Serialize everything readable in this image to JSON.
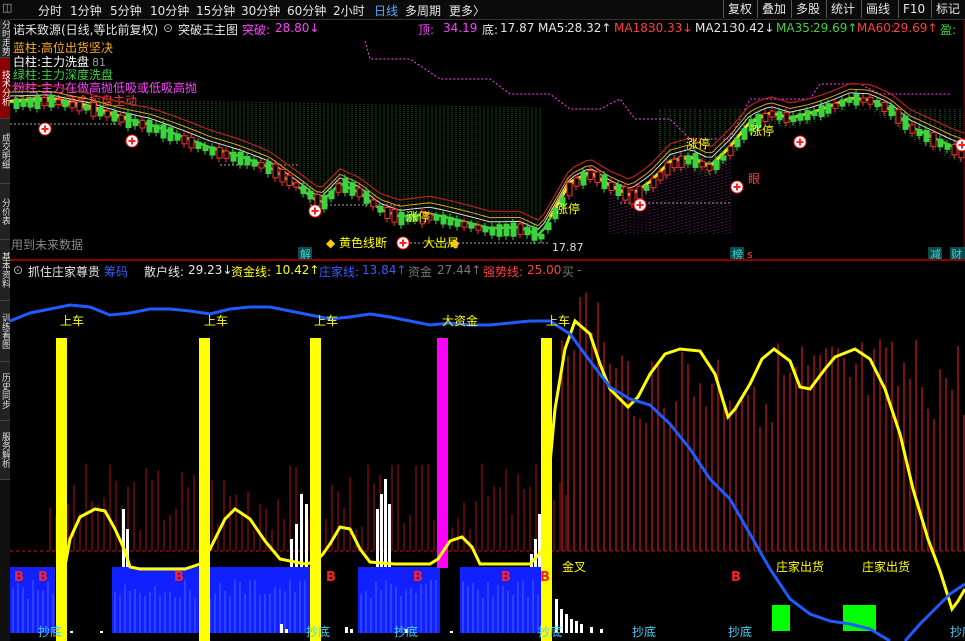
{
  "toolbar": {
    "timeframes": [
      "分时",
      "1分钟",
      "5分钟",
      "10分钟",
      "15分钟",
      "30分钟",
      "60分钟",
      "2小时",
      "日线",
      "多周期",
      "更多〉"
    ],
    "active_timeframe": "日线",
    "right_buttons": [
      "复权",
      "叠加",
      "多股",
      "统计",
      "画线",
      "F10",
      "标记"
    ]
  },
  "left_tabs": [
    "分时走势",
    "技术分析",
    "成交明细",
    "分价表",
    "基本资料",
    "训练看图",
    "历史同步",
    "服务解析"
  ],
  "upper": {
    "stock_name": "诺禾致源(日线,等比前复权)",
    "indicator_name": "突破王主图",
    "breakout_label": "突破:",
    "breakout_value": "28.80↓",
    "top_label": "顶:",
    "top_value": "34.19",
    "bottom_label": "底:",
    "bottom_value": "17.87",
    "ma": [
      {
        "label": "MA5:",
        "value": "28.32↑",
        "color": "#e6e6e6"
      },
      {
        "label": "MA18:",
        "value": "30.33↓",
        "color": "#ff4040"
      },
      {
        "label": "MA21:",
        "value": "30.42↓",
        "color": "#e6e6e6"
      },
      {
        "label": "MA35:",
        "value": "29.69↑",
        "color": "#3fd13f"
      },
      {
        "label": "MA60:",
        "value": "29.69↑",
        "color": "#ff4040"
      },
      {
        "label": "盈:",
        "value": "",
        "color": "#3fd13f"
      }
    ],
    "legend": [
      {
        "text": "蓝柱:高位出货坚决",
        "color": "#ffb020"
      },
      {
        "text": "白柱:主力洗盘",
        "color": "#ffffff"
      },
      {
        "text": "绿柱:主力深度洗盘",
        "color": "#3fd13f"
      },
      {
        "text": "粉柱:主力在做高抛低吸或低吸高抛",
        "color": "#ff40ff"
      },
      {
        "text": "红柱:主力资金控盘主动",
        "color": "#ff4040"
      }
    ],
    "legend_extra": "81",
    "future_data": "用到未来数据",
    "annotations": {
      "zhangting": "涨停",
      "yan": "眼",
      "low_price": "17.87",
      "jie": "解",
      "bang": "榜",
      "s": "s",
      "jian": "减",
      "cai": "财"
    },
    "bottom_legend": [
      "黄色线断",
      "大出局"
    ]
  },
  "lower": {
    "indicator_name": "抓住庄家尊贵",
    "items": [
      {
        "label": "筹码",
        "value": "",
        "color": "#3a5cff"
      },
      {
        "label": "散户线:",
        "value": "29.23↓",
        "color": "#e6e6e6"
      },
      {
        "label": "资金线:",
        "value": "10.42↑",
        "color": "#ffff00"
      },
      {
        "label": "庄家线:",
        "value": "13.84↑",
        "color": "#3a5cff"
      },
      {
        "label": "资金",
        "value": "27.44↑",
        "color": "#777777"
      },
      {
        "label": "强势线:",
        "value": "25.00",
        "color": "#ff4040"
      },
      {
        "label": "买",
        "value": "-",
        "color": "#777777"
      }
    ],
    "signals": {
      "shangche": "上车",
      "dazijin": "大资金",
      "jincha": "金叉",
      "zhuangjia_chuhuo": "庄家出货",
      "chaodi": "抄底",
      "b": "B"
    }
  },
  "colors": {
    "up": "#ff3030",
    "down": "#3fd13f",
    "yellow": "#ffff00",
    "blue": "#1f3bff",
    "magenta": "#ff00ff",
    "grid_red": "#8a0000"
  }
}
